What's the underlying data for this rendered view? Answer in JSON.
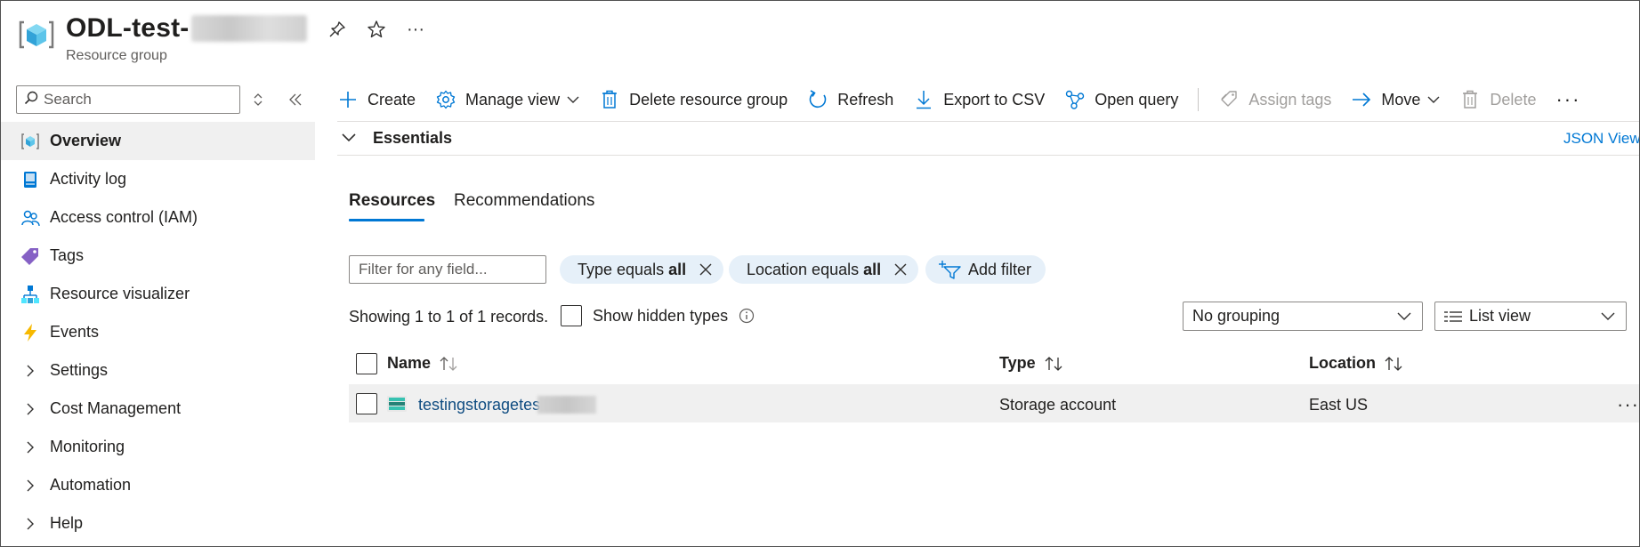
{
  "header": {
    "title": "ODL-test-",
    "subtitle": "Resource group",
    "more": "···"
  },
  "sidebar": {
    "search_placeholder": "Search",
    "items": [
      {
        "label": "Overview",
        "icon": "resource-group-icon",
        "active": true
      },
      {
        "label": "Activity log",
        "icon": "activity-log-icon"
      },
      {
        "label": "Access control (IAM)",
        "icon": "people-icon"
      },
      {
        "label": "Tags",
        "icon": "tag-icon"
      },
      {
        "label": "Resource visualizer",
        "icon": "hierarchy-icon"
      },
      {
        "label": "Events",
        "icon": "lightning-icon"
      },
      {
        "label": "Settings",
        "icon": "chevron-right-icon"
      },
      {
        "label": "Cost Management",
        "icon": "chevron-right-icon"
      },
      {
        "label": "Monitoring",
        "icon": "chevron-right-icon"
      },
      {
        "label": "Automation",
        "icon": "chevron-right-icon"
      },
      {
        "label": "Help",
        "icon": "chevron-right-icon"
      }
    ]
  },
  "toolbar": {
    "create": "Create",
    "manage_view": "Manage view",
    "delete_group": "Delete resource group",
    "refresh": "Refresh",
    "export_csv": "Export to CSV",
    "open_query": "Open query",
    "assign_tags": "Assign tags",
    "move": "Move",
    "delete": "Delete",
    "more": "···"
  },
  "essentials": {
    "label": "Essentials",
    "json_view": "JSON View"
  },
  "tabs": [
    {
      "label": "Resources",
      "active": true
    },
    {
      "label": "Recommendations"
    }
  ],
  "filters": {
    "placeholder": "Filter for any field...",
    "type_pill": {
      "prefix": "Type equals",
      "value": "all"
    },
    "location_pill": {
      "prefix": "Location equals",
      "value": "all"
    },
    "add_filter": "Add filter"
  },
  "records_text": "Showing 1 to 1 of 1 records.",
  "show_hidden": "Show hidden types",
  "grouping": "No grouping",
  "view_mode": "List view",
  "table": {
    "columns": [
      "Name",
      "Type",
      "Location"
    ],
    "rows": [
      {
        "name": "testingstoragetes",
        "type": "Storage account",
        "location": "East US"
      }
    ],
    "row_more": "···"
  },
  "colors": {
    "accent": "#0078d4",
    "pill_bg": "#e6f0f9",
    "selected_bg": "#f0f0f0"
  }
}
